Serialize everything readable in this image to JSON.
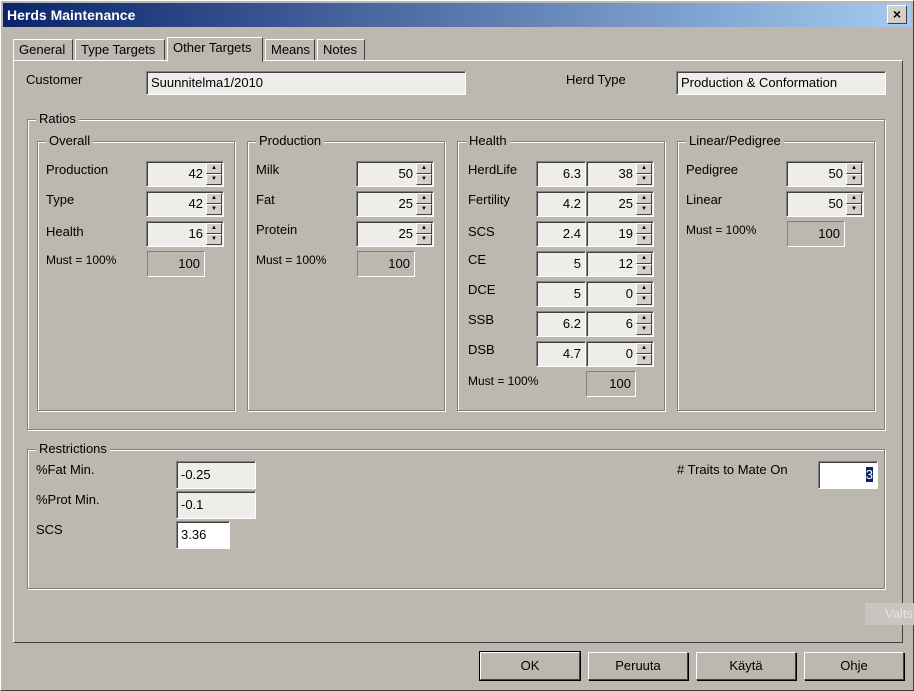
{
  "window": {
    "title": "Herds Maintenance",
    "close": "×"
  },
  "tabs": [
    {
      "label": "General"
    },
    {
      "label": "Type Targets"
    },
    {
      "label": "Other Targets"
    },
    {
      "label": "Means"
    },
    {
      "label": "Notes"
    }
  ],
  "header": {
    "customer_label": "Customer",
    "customer_value": "Suunnitelma1/2010",
    "herd_type_label": "Herd Type",
    "herd_type_value": "Production & Conformation"
  },
  "ratios": {
    "legend": "Ratios",
    "overall": {
      "legend": "Overall",
      "rows": [
        {
          "label": "Production",
          "value": "42"
        },
        {
          "label": "Type",
          "value": "42"
        },
        {
          "label": "Health",
          "value": "16"
        }
      ],
      "must_label": "Must = 100%",
      "total": "100"
    },
    "production": {
      "legend": "Production",
      "rows": [
        {
          "label": "Milk",
          "value": "50"
        },
        {
          "label": "Fat",
          "value": "25"
        },
        {
          "label": "Protein",
          "value": "25"
        }
      ],
      "must_label": "Must = 100%",
      "total": "100"
    },
    "health": {
      "legend": "Health",
      "rows": [
        {
          "label": "HerdLife",
          "a": "6.3",
          "value": "38"
        },
        {
          "label": "Fertility",
          "a": "4.2",
          "value": "25"
        },
        {
          "label": "SCS",
          "a": "2.4",
          "value": "19"
        },
        {
          "label": "CE",
          "a": "5",
          "value": "12"
        },
        {
          "label": "DCE",
          "a": "5",
          "value": "0"
        },
        {
          "label": "SSB",
          "a": "6.2",
          "value": "6"
        },
        {
          "label": "DSB",
          "a": "4.7",
          "value": "0"
        }
      ],
      "must_label": "Must = 100%",
      "total": "100"
    },
    "linear": {
      "legend": "Linear/Pedigree",
      "rows": [
        {
          "label": "Pedigree",
          "value": "50"
        },
        {
          "label": "Linear",
          "value": "50"
        }
      ],
      "must_label": "Must = 100%",
      "total": "100"
    }
  },
  "restrictions": {
    "legend": "Restrictions",
    "fat_label": "%Fat Min.",
    "fat_value": "-0.25",
    "prot_label": "%Prot Min.",
    "prot_value": "-0.1",
    "scs_label": "SCS",
    "scs_value": "3.36",
    "traits_label": "# Traits to Mate On",
    "traits_value": "3"
  },
  "ghost_label": "Valts",
  "buttons": {
    "ok": "OK",
    "cancel": "Peruuta",
    "apply": "Käytä",
    "help": "Ohje"
  }
}
